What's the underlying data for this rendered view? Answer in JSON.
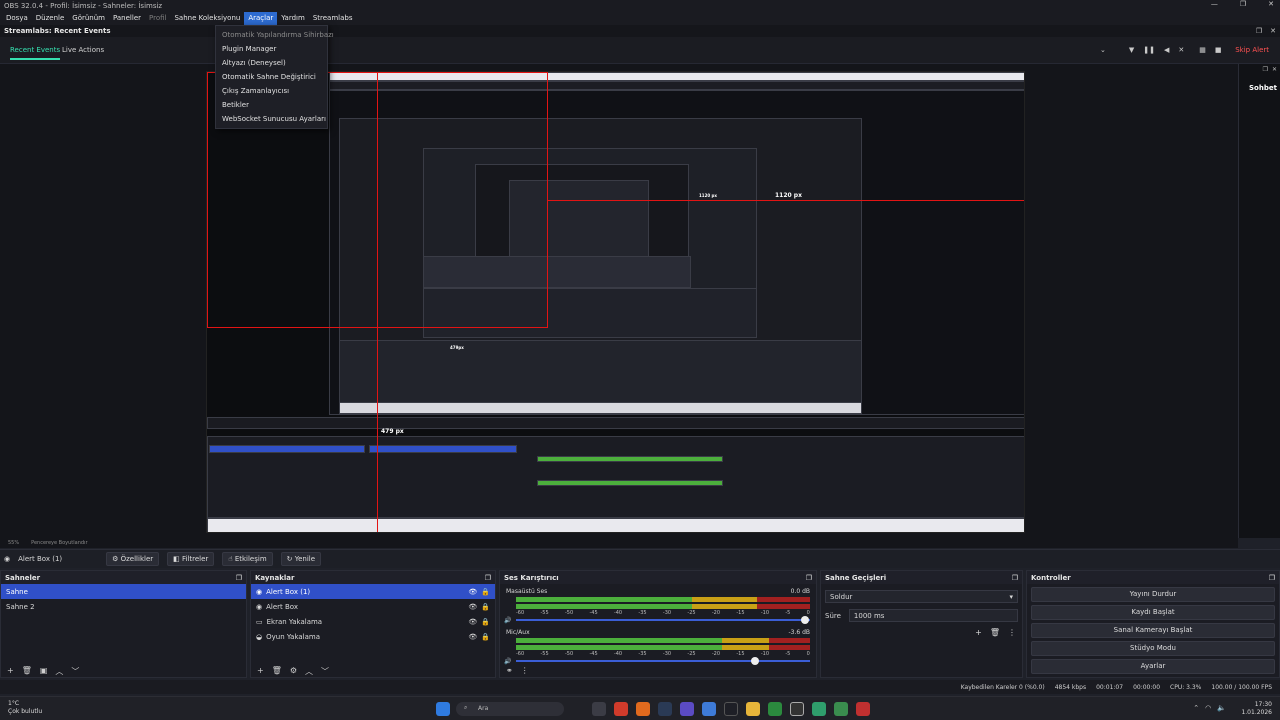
{
  "window": {
    "title": "OBS 32.0.4 - Profil: İsimsiz - Sahneler: İsimsiz"
  },
  "menu": {
    "items": [
      "Dosya",
      "Düzenle",
      "Görünüm",
      "Paneller",
      "Profil",
      "Sahne Koleksiyonu",
      "Araçlar",
      "Yardım",
      "Streamlabs"
    ],
    "active": "Araçlar"
  },
  "dropdown": {
    "items": [
      "Otomatik Yapılandırma Sihirbazı",
      "Plugin Manager",
      "Altyazı (Deneysel)",
      "Otomatik Sahne Değiştirici",
      "Çıkış Zamanlayıcısı",
      "Betikler",
      "WebSocket Sunucusu Ayarları"
    ]
  },
  "recent_events_dock": {
    "title": "Streamlabs: Recent Events",
    "tabs": [
      "Recent Events",
      "Live Actions"
    ],
    "skip_alert": "Skip Alert"
  },
  "preview": {
    "labels": {
      "px1": "1120 px",
      "px2": "1120 px",
      "px3": "479 px",
      "px4": "479px"
    }
  },
  "right_dock": {
    "title": "Sohbet"
  },
  "status_row": {
    "zoom": "55%",
    "resize": "Pencereye Boyutlandır"
  },
  "source_toolbar": {
    "source": "Alert Box (1)",
    "properties": "Özellikler",
    "filters": "Filtreler",
    "interact": "Etkileşim",
    "refresh": "Yenile"
  },
  "scenes": {
    "title": "Sahneler",
    "items": [
      "Sahne",
      "Sahne 2"
    ]
  },
  "sources": {
    "title": "Kaynaklar",
    "items": [
      "Alert Box (1)",
      "Alert Box",
      "Ekran Yakalama",
      "Oyun Yakalama"
    ]
  },
  "audio_mixer": {
    "title": "Ses Karıştırıcı",
    "channels": [
      {
        "name": "Masaüstü Ses",
        "db": "0.0 dB",
        "level": 0.9
      },
      {
        "name": "Mic/Aux",
        "db": "-3.6 dB",
        "level": 0.75
      }
    ],
    "scale": [
      "-60",
      "-55",
      "-50",
      "-45",
      "-40",
      "-35",
      "-30",
      "-25",
      "-20",
      "-15",
      "-10",
      "-5",
      "0"
    ]
  },
  "transitions": {
    "title": "Sahne Geçişleri",
    "type": "Soldur",
    "duration_label": "Süre",
    "duration": "1000 ms"
  },
  "controls": {
    "title": "Kontroller",
    "buttons": [
      "Yayını Durdur",
      "Kaydı Başlat",
      "Sanal Kamerayı Başlat",
      "Stüdyo Modu",
      "Ayarlar"
    ]
  },
  "obs_status": {
    "dropped": "Kaybedilen Kareler 0 (%0.0)",
    "bitrate": "4854 kbps",
    "live_time": "00:01:07",
    "rec_time": "00:00:00",
    "cpu": "CPU: 3.3%",
    "fps": "100.00 / 100.00 FPS"
  },
  "taskbar": {
    "temp": "1°C",
    "weather": "Çok bulutlu",
    "search": "Ara",
    "time": "17:30",
    "date": "1.01.2026"
  },
  "colors": {
    "accent": "#3050c8",
    "brand": "#36e0b0",
    "alert": "#ff5252",
    "red_guides": "#e21414"
  }
}
